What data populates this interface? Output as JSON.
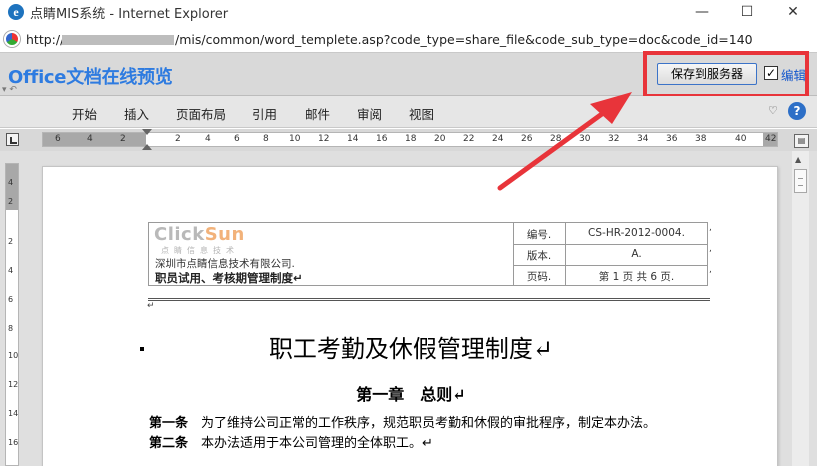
{
  "window": {
    "title": "点睛MIS系统 - Internet Explorer",
    "minimize": "—",
    "maximize": "☐",
    "close": "✕",
    "logo_letter": "e"
  },
  "address": {
    "prefix": "http://",
    "path": "/mis/common/word_templete.asp?code_type=share_file&code_sub_type=doc&code_id=140"
  },
  "header": {
    "title": "Office文档在线预览",
    "save_button": "保存到服务器",
    "edit_checked": true,
    "edit_label": "编辑",
    "quick_access": "▾ ↶"
  },
  "ribbon": {
    "tabs": [
      "开始",
      "插入",
      "页面布局",
      "引用",
      "邮件",
      "审阅",
      "视图"
    ],
    "collapse_icon": "♡",
    "help_label": "?"
  },
  "ruler": {
    "numbers": [
      "6",
      "4",
      "2",
      "2",
      "4",
      "6",
      "8",
      "10",
      "12",
      "14",
      "16",
      "18",
      "20",
      "22",
      "24",
      "26",
      "28",
      "30",
      "32",
      "34",
      "36",
      "38",
      "40",
      "42"
    ],
    "vnumbers": [
      "4",
      "2",
      "2",
      "4",
      "6",
      "8",
      "10",
      "12",
      "14",
      "16"
    ]
  },
  "document": {
    "logo_click": "Click",
    "logo_sun": "Sun",
    "logo_sub": "点睛信息技术",
    "company": "深圳市点睛信息技术有限公司.",
    "doc_name": "职员试用、考核期管理制度↵",
    "rows": [
      {
        "label": "编号.",
        "value": "CS-HR-2012-0004."
      },
      {
        "label": "版本.",
        "value": "A."
      },
      {
        "label": "页码.",
        "value": "第 1 页 共 6 页."
      }
    ],
    "title": "职工考勤及休假管理制度↵",
    "chapter": "第一章　总则↵",
    "articles": [
      {
        "num": "第一条",
        "text": "　为了维持公司正常的工作秩序，规范职员考勤和休假的审批程序，制定本办法。"
      },
      {
        "num": "第二条",
        "text": "　本办法适用于本公司管理的全体职工。↵"
      }
    ],
    "para_mark": "↵"
  },
  "annotation": {
    "highlight_color": "#e8343a"
  }
}
